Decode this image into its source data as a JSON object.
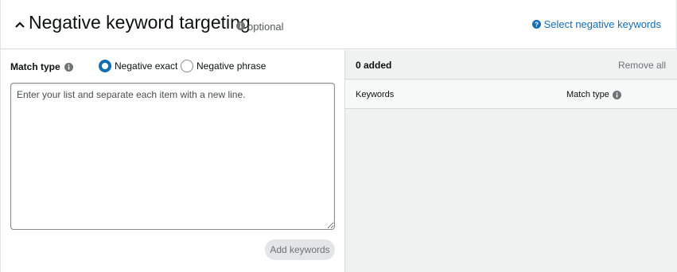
{
  "header": {
    "title": "Negative keyword targeting",
    "optional_label": "optional",
    "help_link": "Select negative keywords"
  },
  "form": {
    "match_type_label": "Match type",
    "options": [
      {
        "label": "Negative exact",
        "selected": true
      },
      {
        "label": "Negative phrase",
        "selected": false
      }
    ],
    "textarea_placeholder": "Enter your list and separate each item with a new line.",
    "add_button": "Add keywords"
  },
  "added_panel": {
    "count_label": "0 added",
    "remove_all": "Remove all",
    "columns": [
      "Keywords",
      "Match type"
    ]
  },
  "colors": {
    "accent": "#146eb4",
    "panel_bg": "#f0f2f2",
    "border": "#d5d9d9"
  }
}
